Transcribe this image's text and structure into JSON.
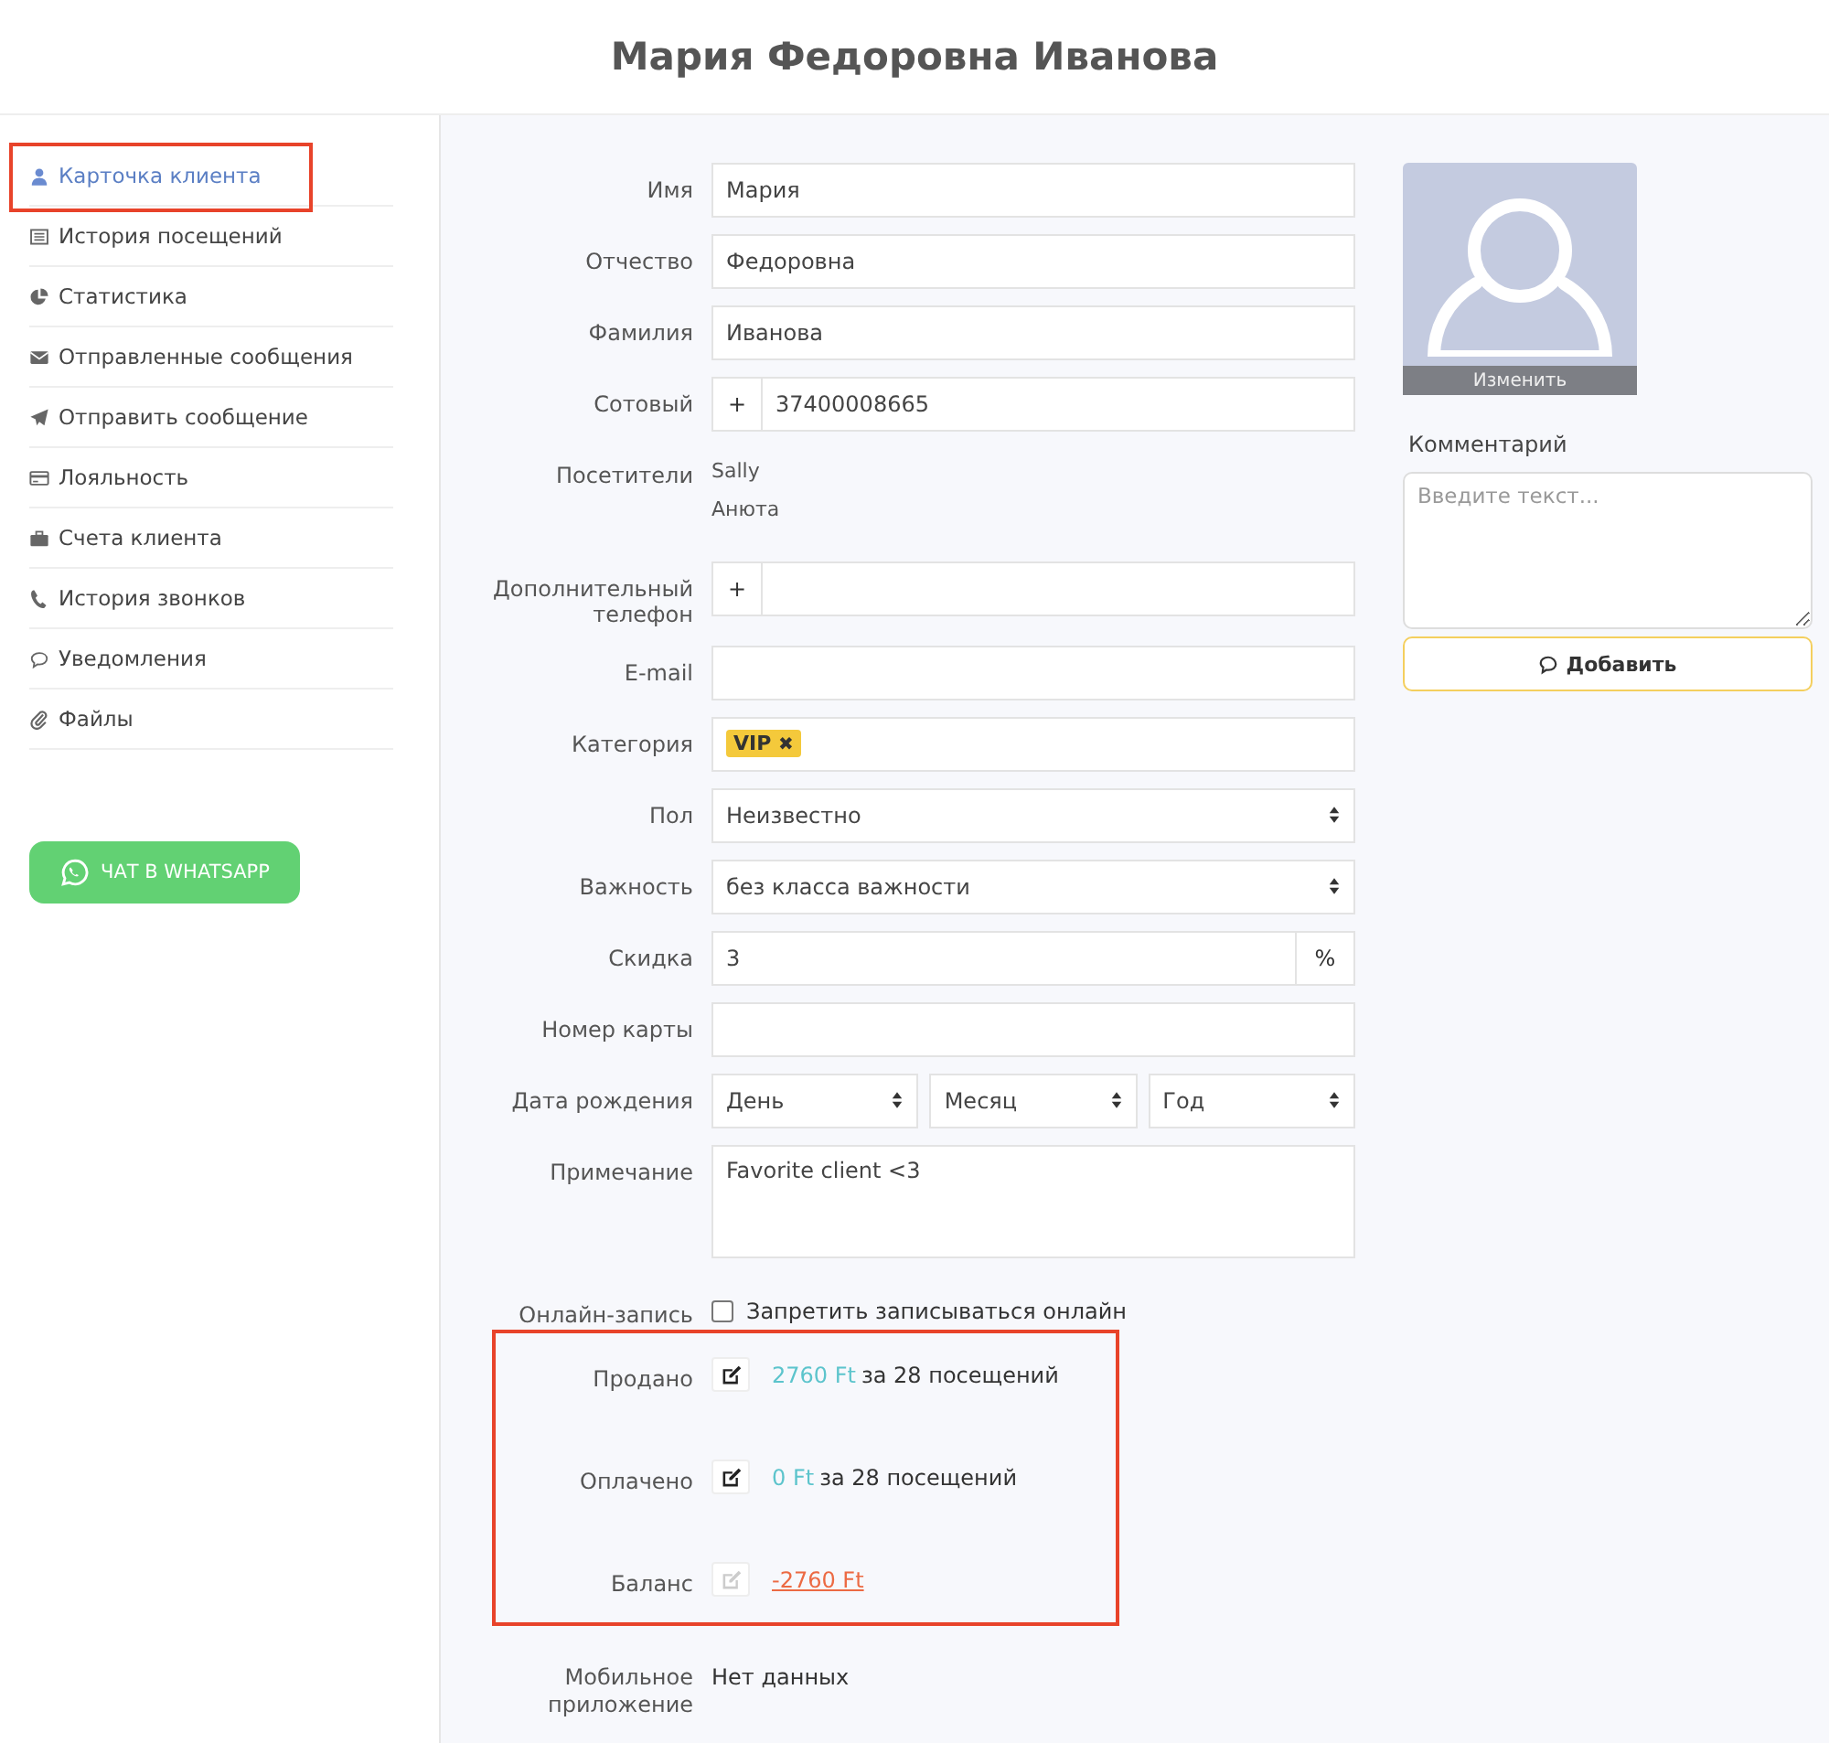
{
  "header": {
    "title": "Мария Федоровна Иванова"
  },
  "sidebar": {
    "items": [
      {
        "label": "Карточка клиента",
        "selected": true,
        "highlighted": true
      },
      {
        "label": "История посещений",
        "selected": false,
        "highlighted": false
      },
      {
        "label": "Статистика",
        "selected": false,
        "highlighted": false
      },
      {
        "label": "Отправленные сообщения",
        "selected": false,
        "highlighted": false
      },
      {
        "label": "Отправить сообщение",
        "selected": false,
        "highlighted": false
      },
      {
        "label": "Лояльность",
        "selected": false,
        "highlighted": false
      },
      {
        "label": "Счета клиента",
        "selected": false,
        "highlighted": false
      },
      {
        "label": "История звонков",
        "selected": false,
        "highlighted": false
      },
      {
        "label": "Уведомления",
        "selected": false,
        "highlighted": false
      },
      {
        "label": "Файлы",
        "selected": false,
        "highlighted": false
      }
    ],
    "whatsapp_button": "ЧАТ В WHATSAPP"
  },
  "form": {
    "rows": [
      {
        "kind": "text",
        "label": "Имя",
        "value": "Мария"
      },
      {
        "kind": "text",
        "label": "Отчество",
        "value": "Федоровна"
      },
      {
        "kind": "text",
        "label": "Фамилия",
        "value": "Иванова"
      },
      {
        "kind": "phone",
        "label": "Сотовый",
        "prefix": "+",
        "value": "37400008665"
      },
      {
        "kind": "list",
        "label": "Посетители",
        "items": [
          "Sally",
          "Анюта"
        ]
      },
      {
        "kind": "phone",
        "label": "Дополнительный телефон",
        "prefix": "+"
      },
      {
        "kind": "text",
        "label": "E-mail"
      },
      {
        "kind": "tags",
        "label": "Категория",
        "tags": [
          {
            "label": "VIP",
            "remove": "✖"
          }
        ]
      },
      {
        "kind": "select",
        "label": "Пол",
        "value": "Неизвестно"
      },
      {
        "kind": "select",
        "label": "Важность",
        "value": "без класса важности"
      },
      {
        "kind": "suffix",
        "label": "Скидка",
        "value": "3",
        "suffix": "%"
      },
      {
        "kind": "text",
        "label": "Номер карты"
      },
      {
        "kind": "date",
        "label": "Дата рождения",
        "parts": [
          "День",
          "Месяц",
          "Год"
        ]
      },
      {
        "kind": "textarea",
        "label": "Примечание",
        "value": "Favorite client <3"
      },
      {
        "kind": "checkbox",
        "label": "Онлайн-запись",
        "text": "Запретить записываться онлайн",
        "checked": false
      }
    ],
    "finance": {
      "highlighted": true,
      "rows": [
        {
          "label": "Продано",
          "editable": true,
          "amount": "2760 Ft",
          "negative": false,
          "suffix": "за 28 посещений"
        },
        {
          "label": "Оплачено",
          "editable": true,
          "amount": "0 Ft",
          "negative": false,
          "suffix": "за 28 посещений"
        },
        {
          "label": "Баланс",
          "editable": false,
          "amount": "-2760 Ft",
          "negative": true
        }
      ]
    },
    "mobile_app": {
      "label": "Мобильное приложение",
      "value": "Нет данных"
    }
  },
  "side_panel": {
    "photo_button": "Изменить",
    "comment_label": "Комментарий",
    "comment_placeholder": "Введите текст...",
    "add_button": "Добавить"
  }
}
